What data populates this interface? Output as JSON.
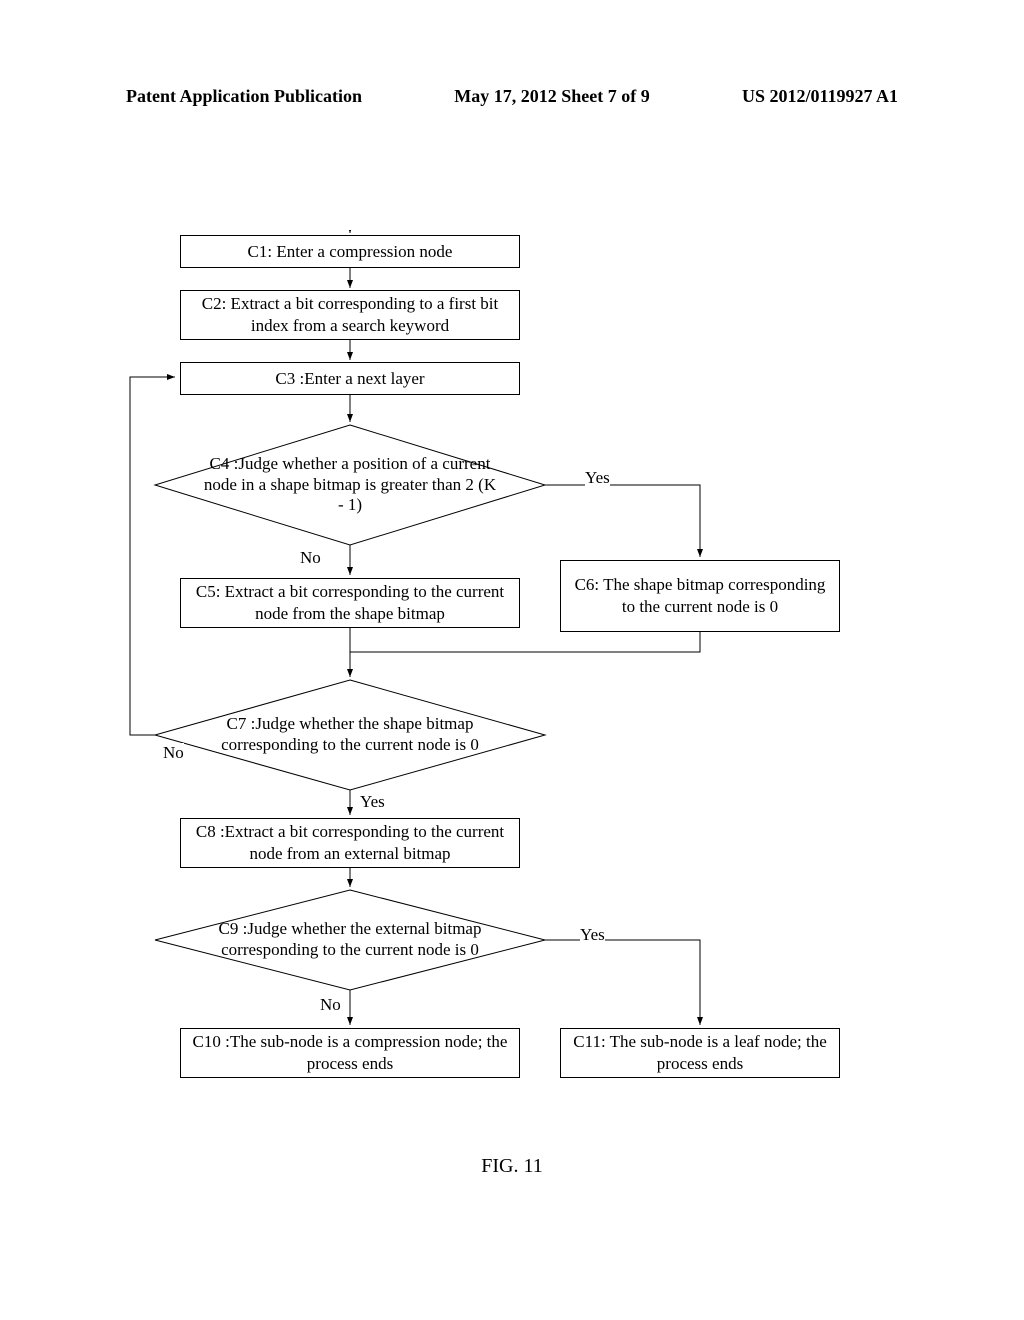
{
  "header": {
    "left": "Patent Application Publication",
    "center": "May 17, 2012  Sheet 7 of 9",
    "right": "US 2012/0119927 A1"
  },
  "steps": {
    "c1": "C1: Enter a compression node",
    "c2": "C2: Extract a bit corresponding to a first bit index from a search keyword",
    "c3": "C3 :Enter a next layer",
    "c4": "C4 :Judge whether a position of a current node in a shape bitmap is greater than 2 (K - 1)",
    "c5": "C5: Extract a bit corresponding to the current node from the shape bitmap",
    "c6": "C6: The shape bitmap corresponding to the current node is 0",
    "c7": "C7 :Judge whether the shape bitmap corresponding to the current node is 0",
    "c8": "C8 :Extract a bit corresponding to the current node from an external bitmap",
    "c9": "C9 :Judge whether the external bitmap corresponding to the current node is 0",
    "c10": "C10 :The sub-node is a compression node; the process ends",
    "c11": "C11: The sub-node is a leaf node; the process ends"
  },
  "labels": {
    "yes": "Yes",
    "no": "No"
  },
  "figure": "FIG. 11",
  "chart_data": {
    "type": "flowchart",
    "nodes": [
      {
        "id": "C1",
        "kind": "process",
        "text": "Enter a compression node"
      },
      {
        "id": "C2",
        "kind": "process",
        "text": "Extract a bit corresponding to a first bit index from a search keyword"
      },
      {
        "id": "C3",
        "kind": "process",
        "text": "Enter a next layer"
      },
      {
        "id": "C4",
        "kind": "decision",
        "text": "Judge whether a position of a current node in a shape bitmap is greater than 2 (K - 1)"
      },
      {
        "id": "C5",
        "kind": "process",
        "text": "Extract a bit corresponding to the current node from the shape bitmap"
      },
      {
        "id": "C6",
        "kind": "process",
        "text": "The shape bitmap corresponding to the current node is 0"
      },
      {
        "id": "C7",
        "kind": "decision",
        "text": "Judge whether the shape bitmap corresponding to the current node is 0"
      },
      {
        "id": "C8",
        "kind": "process",
        "text": "Extract a bit corresponding to the current node from an external bitmap"
      },
      {
        "id": "C9",
        "kind": "decision",
        "text": "Judge whether the external bitmap corresponding to the current node is 0"
      },
      {
        "id": "C10",
        "kind": "terminal",
        "text": "The sub-node is a compression node; the process ends"
      },
      {
        "id": "C11",
        "kind": "terminal",
        "text": "The sub-node is a leaf node; the process ends"
      }
    ],
    "edges": [
      {
        "from": "C1",
        "to": "C2"
      },
      {
        "from": "C2",
        "to": "C3"
      },
      {
        "from": "C3",
        "to": "C4"
      },
      {
        "from": "C4",
        "to": "C5",
        "label": "No"
      },
      {
        "from": "C4",
        "to": "C6",
        "label": "Yes"
      },
      {
        "from": "C5",
        "to": "C7"
      },
      {
        "from": "C6",
        "to": "C7"
      },
      {
        "from": "C7",
        "to": "C3",
        "label": "No"
      },
      {
        "from": "C7",
        "to": "C8",
        "label": "Yes"
      },
      {
        "from": "C8",
        "to": "C9"
      },
      {
        "from": "C9",
        "to": "C10",
        "label": "No"
      },
      {
        "from": "C9",
        "to": "C11",
        "label": "Yes"
      }
    ]
  }
}
